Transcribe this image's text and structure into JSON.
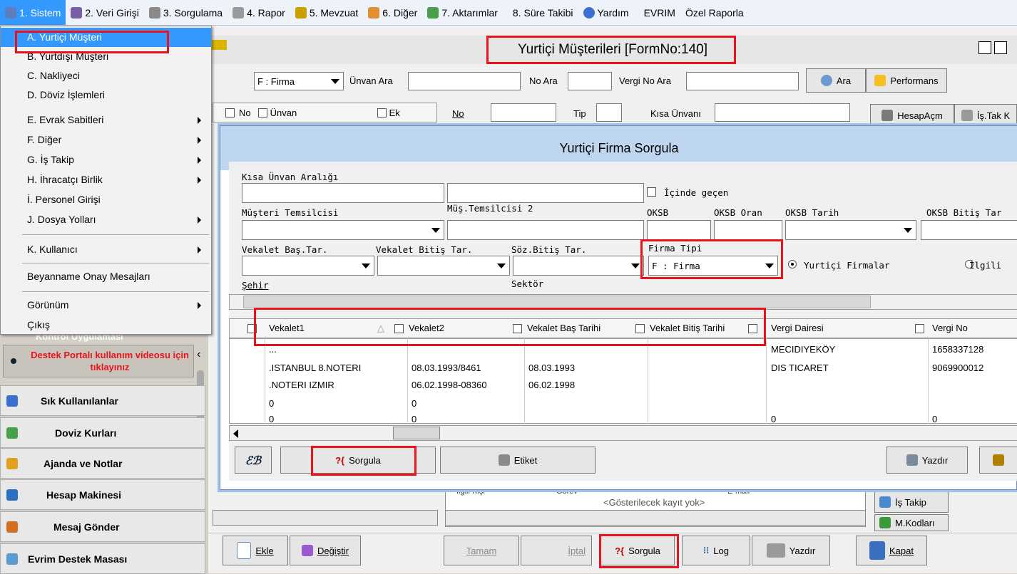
{
  "menubar": {
    "items": [
      {
        "label": "1. Sistem",
        "icon": "system-icon"
      },
      {
        "label": "2. Veri Girişi",
        "icon": "data-entry-icon"
      },
      {
        "label": "3. Sorgulama",
        "icon": "query-icon"
      },
      {
        "label": "4. Rapor",
        "icon": "printer-icon"
      },
      {
        "label": "5. Mevzuat",
        "icon": "books-icon"
      },
      {
        "label": "6. Diğer",
        "icon": "other-icon"
      },
      {
        "label": "7. Aktarımlar",
        "icon": "transfer-icon"
      },
      {
        "label": "8. Süre Takibi",
        "icon": ""
      },
      {
        "label": "Yardım",
        "icon": "help-icon"
      },
      {
        "label": "EVRIM",
        "icon": ""
      },
      {
        "label": "Özel Raporla",
        "icon": ""
      }
    ]
  },
  "dropdown": {
    "items": [
      {
        "label": "A.  Yurtiçi Müşteri",
        "submenu": false
      },
      {
        "label": "B.  Yurtdışı Müşteri",
        "submenu": false
      },
      {
        "label": "C.  Nakliyeci",
        "submenu": false
      },
      {
        "label": "D.  Döviz İşlemleri",
        "submenu": false
      },
      {
        "label": "E.  Evrak Sabitleri",
        "submenu": true
      },
      {
        "label": "F.  Diğer",
        "submenu": true
      },
      {
        "label": "G.  İş Takip",
        "submenu": true
      },
      {
        "label": "H.  İhracatçı Birlik",
        "submenu": true
      },
      {
        "label": "İ.   Personel Girişi",
        "submenu": false
      },
      {
        "label": "J.  Dosya Yolları",
        "submenu": true
      },
      {
        "label": "K.  Kullanıcı",
        "submenu": true
      },
      {
        "label": "Beyanname Onay Mesajları",
        "submenu": false
      },
      {
        "label": "Görünüm",
        "submenu": true
      },
      {
        "label": "Çıkış",
        "submenu": false
      }
    ]
  },
  "main": {
    "title": "Yurtiçi Müşterileri [FormNo:140]",
    "search": {
      "type_value": "F : Firma",
      "unvan_label": "Ünvan Ara",
      "no_label": "No Ara",
      "vergi_label": "Vergi No Ara",
      "ara_button": "Ara",
      "performans_button": "Performans"
    },
    "list_header": {
      "no": "No",
      "unvan": "Ünvan",
      "ek": "Ek"
    },
    "detail": {
      "no_label": "No",
      "tip_label": "Tip",
      "kisa_label": "Kısa Ünvanı"
    },
    "right_buttons": {
      "hesap": "HesapAçm",
      "istak": "İş.Tak K",
      "istakip": "İş Takip",
      "mkod": "M.Kodları"
    },
    "no_records": "<Gösterilecek kayıt yok>",
    "contact_headers": {
      "ilgili": "İlgili Kişi",
      "gorev": "Görev",
      "email": "E-mail"
    }
  },
  "dialog": {
    "title": "Yurtiçi Firma Sorgula",
    "labels": {
      "kisa_unvan": "Kısa Ünvan Aralığı",
      "icinde": "İçinde geçen",
      "temsilci": "Müşteri Temsilcisi",
      "temsilci2": "Müş.Temsilcisi 2",
      "oksb": "OKSB",
      "oksb_oran": "OKSB Oran",
      "oksb_tarih": "OKSB Tarih",
      "oksb_bitis": "OKSB Bitiş Tar",
      "vekalet_bas": "Vekalet  Baş.Tar.",
      "vekalet_bitis": "Vekalet Bitiş Tar.",
      "soz_bitis": "Söz.Bitiş Tar.",
      "firma_tipi": "Firma Tipi",
      "firma_tipi_value": "F : Firma",
      "radio_yurtici": "Yurtiçi Firmalar",
      "radio_ilgili": "İlgili",
      "sehir": "Şehir",
      "sektor": "Sektör"
    },
    "grid": {
      "columns": [
        "Vekalet1",
        "Vekalet2",
        "Vekalet Baş Tarihi",
        "Vekalet Bitiş Tarihi",
        "Vergi Dairesi",
        "Vergi No"
      ],
      "rows": [
        [
          "...",
          "",
          "",
          "",
          "MECIDIYEKÖY",
          "1658337128"
        ],
        [
          ".ISTANBUL 8.NOTERI",
          "08.03.1993/8461",
          "08.03.1993",
          "",
          "DIS TICARET",
          "9069900012"
        ],
        [
          ".NOTERI IZMIR",
          "06.02.1998-08360",
          "06.02.1998",
          "",
          "",
          ""
        ],
        [
          "0",
          "0",
          "",
          "",
          "",
          ""
        ],
        [
          "0",
          "0",
          "",
          "",
          "0",
          "0"
        ]
      ]
    },
    "buttons": {
      "sorgula": "Sorgula",
      "etiket": "Etiket",
      "yazdir": "Yazdır"
    }
  },
  "sidebar": {
    "promo_top": "Kontrol Uygulaması",
    "promo": "Destek Portalı kullanım videosu için tıklayınız",
    "items": [
      {
        "label": "Sık Kullanılanlar",
        "icon": "favorites-icon"
      },
      {
        "label": "Doviz Kurları",
        "icon": "currency-icon"
      },
      {
        "label": "Ajanda ve Notlar",
        "icon": "notes-icon"
      },
      {
        "label": "Hesap Makinesi",
        "icon": "calculator-icon"
      },
      {
        "label": "Mesaj Gönder",
        "icon": "message-icon"
      },
      {
        "label": "Evrim Destek Masası",
        "icon": "support-icon"
      }
    ]
  },
  "bottom": {
    "ekle": "Ekle",
    "degistir": "Değiştir",
    "tamam": "Tamam",
    "iptal": "İptal",
    "sorgula": "Sorgula",
    "log": "Log",
    "yazdir": "Yazdır",
    "kapat": "Kapat"
  },
  "colors": {
    "highlight": "#3399ff",
    "annotation": "#e8131b",
    "promo_text": "#e8131b"
  }
}
